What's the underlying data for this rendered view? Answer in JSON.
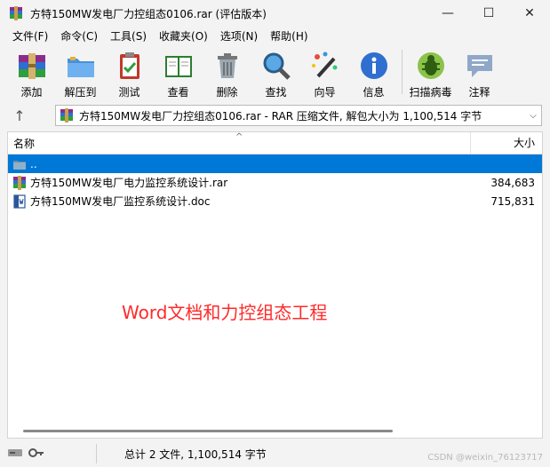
{
  "window": {
    "title": "方特150MW发电厂力控组态0106.rar (评估版本)",
    "minimize_glyph": "—",
    "maximize_glyph": "☐",
    "close_glyph": "✕"
  },
  "menu": [
    {
      "label": "文件(F)"
    },
    {
      "label": "命令(C)"
    },
    {
      "label": "工具(S)"
    },
    {
      "label": "收藏夹(O)"
    },
    {
      "label": "选项(N)"
    },
    {
      "label": "帮助(H)"
    }
  ],
  "toolbar": {
    "add": "添加",
    "extract": "解压到",
    "test": "测试",
    "view": "查看",
    "delete": "删除",
    "find": "查找",
    "wizard": "向导",
    "info": "信息",
    "scan": "扫描病毒",
    "comment": "注释"
  },
  "address": {
    "up_glyph": "↑",
    "text": "方特150MW发电厂力控组态0106.rar - RAR 压缩文件, 解包大小为 1,100,514 字节",
    "dropdown_glyph": "⌵"
  },
  "columns": {
    "name": "名称",
    "size": "大小",
    "sort_glyph": "^"
  },
  "files": [
    {
      "name": "..",
      "size": "",
      "icon": "folder-icon"
    },
    {
      "name": "方特150MW发电厂电力监控系统设计.rar",
      "size": "384,683",
      "icon": "rar-file-icon"
    },
    {
      "name": "方特150MW发电厂监控系统设计.doc",
      "size": "715,831",
      "icon": "word-file-icon"
    }
  ],
  "annotation": "Word文档和力控组态工程",
  "status": {
    "summary": "总计 2 文件, 1,100,514 字节"
  },
  "watermark": "CSDN @weixin_76123717",
  "colors": {
    "selection": "#0078d7",
    "annotation": "#ff2a2a"
  }
}
